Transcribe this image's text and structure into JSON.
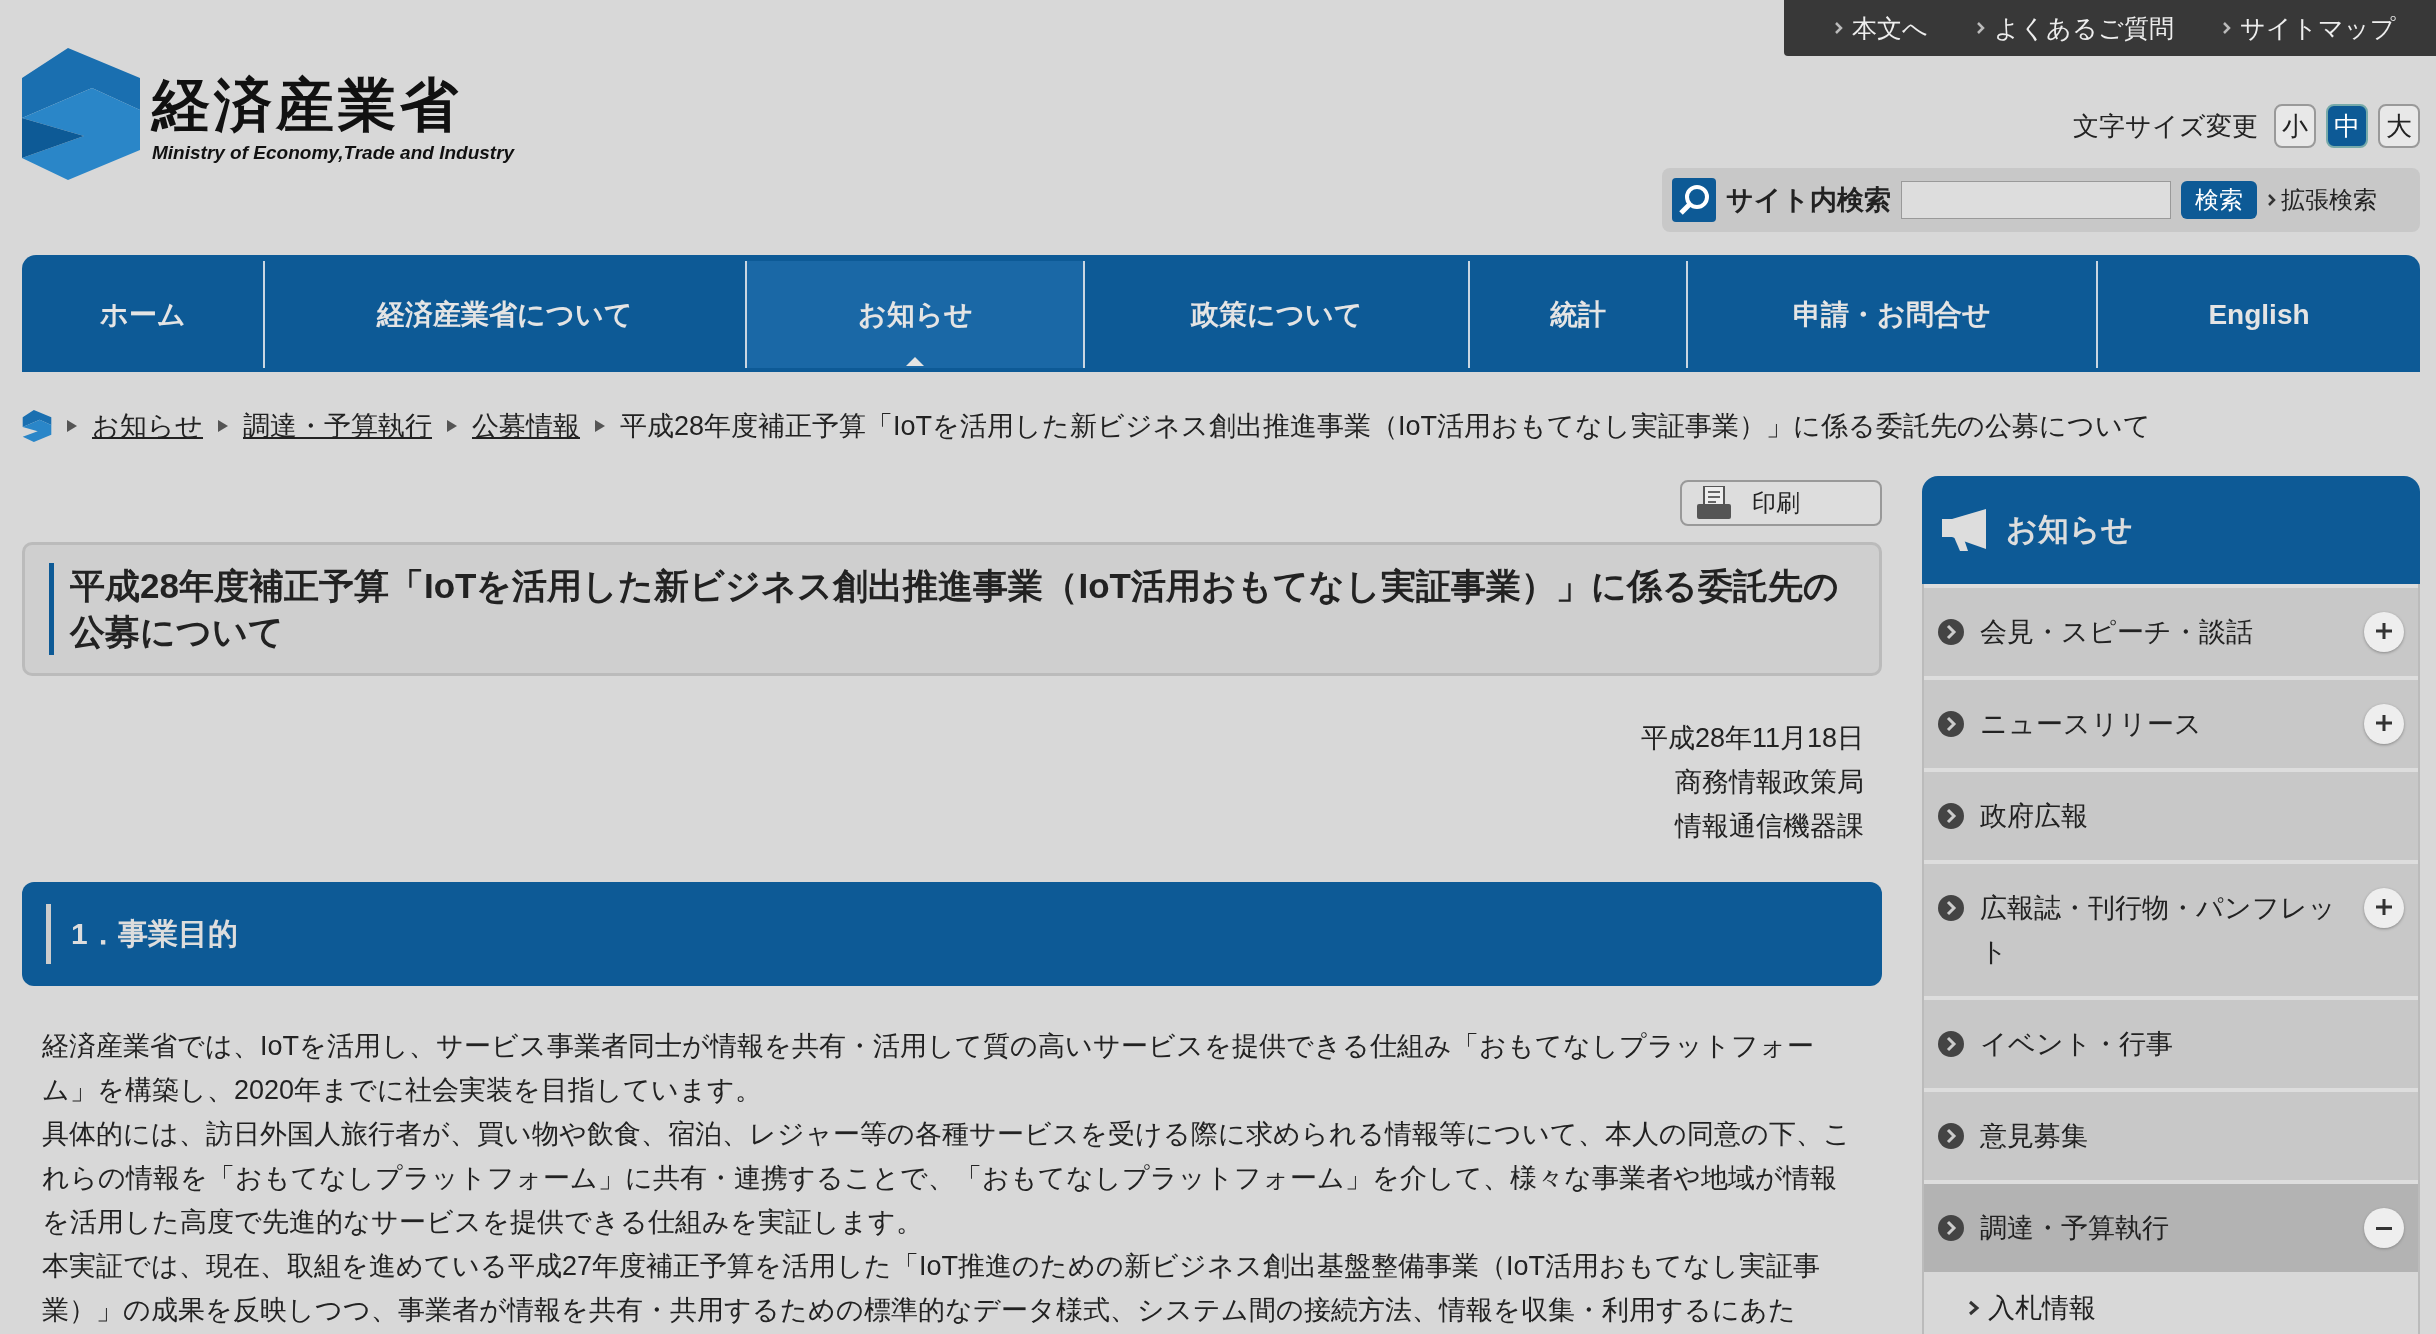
{
  "utility_links": [
    "本文へ",
    "よくあるご質問",
    "サイトマップ"
  ],
  "logo": {
    "name": "経済産業省",
    "subtitle": "Ministry of Economy,Trade and Industry"
  },
  "font_size": {
    "label": "文字サイズ変更",
    "options": [
      {
        "label": "小",
        "selected": false
      },
      {
        "label": "中",
        "selected": true
      },
      {
        "label": "大",
        "selected": false
      }
    ]
  },
  "search": {
    "label": "サイト内検索",
    "button": "検索",
    "advanced": "拡張検索"
  },
  "nav": [
    {
      "label": "ホーム",
      "selected": false
    },
    {
      "label": "経済産業省について",
      "selected": false
    },
    {
      "label": "お知らせ",
      "selected": true
    },
    {
      "label": "政策について",
      "selected": false
    },
    {
      "label": "統計",
      "selected": false
    },
    {
      "label": "申請・お問合せ",
      "selected": false
    },
    {
      "label": "English",
      "selected": false
    }
  ],
  "breadcrumb": {
    "links": [
      "お知らせ",
      "調達・予算執行",
      "公募情報"
    ],
    "current": "平成28年度補正予算「IoTを活用した新ビジネス創出推進事業（IoT活用おもてなし実証事業）」に係る委託先の公募について"
  },
  "print_button": "印刷",
  "title": "平成28年度補正予算「IoTを活用した新ビジネス創出推進事業（IoT活用おもてなし実証事業）」に係る委託先の公募について",
  "meta": [
    "平成28年11月18日",
    "商務情報政策局",
    "情報通信機器課"
  ],
  "section": {
    "heading": "1．事業目的",
    "paragraphs": [
      "経済産業省では、IoTを活用し、サービス事業者同士が情報を共有・活用して質の高いサービスを提供できる仕組み「おもてなしプラットフォーム」を構築し、2020年までに社会実装を目指しています。",
      "具体的には、訪日外国人旅行者が、買い物や飲食、宿泊、レジャー等の各種サービスを受ける際に求められる情報等について、本人の同意の下、これらの情報を「おもてなしプラットフォーム」に共有・連携することで、「おもてなしプラットフォーム」を介して、様々な事業者や地域が情報を活用した高度で先進的なサービスを提供できる仕組みを実証します。",
      "本実証では、現在、取組を進めている平成27年度補正予算を活用した「IoT推進のための新ビジネス創出基盤整備事業（IoT活用おもてなし実証事業）」の成果を反映しつつ、事業者が情報を共有・共用するための標準的なデータ様式、システム間の接続方法、情報を収集・利用するにあた"
    ]
  },
  "sidebar": {
    "title": "お知らせ",
    "items": [
      {
        "label": "会見・スピーチ・談話",
        "kind": "expandable",
        "expanded": false,
        "selected": false
      },
      {
        "label": "ニュースリリース",
        "kind": "expandable",
        "expanded": false,
        "selected": false
      },
      {
        "label": "政府広報",
        "kind": "plain",
        "selected": false
      },
      {
        "label": "広報誌・刊行物・パンフレット",
        "kind": "expandable",
        "expanded": false,
        "selected": false
      },
      {
        "label": "イベント・行事",
        "kind": "plain",
        "selected": false
      },
      {
        "label": "意見募集",
        "kind": "plain",
        "selected": false
      },
      {
        "label": "調達・予算執行",
        "kind": "expandable",
        "expanded": true,
        "selected": true,
        "children": [
          {
            "label": "入札情報"
          }
        ]
      }
    ]
  }
}
